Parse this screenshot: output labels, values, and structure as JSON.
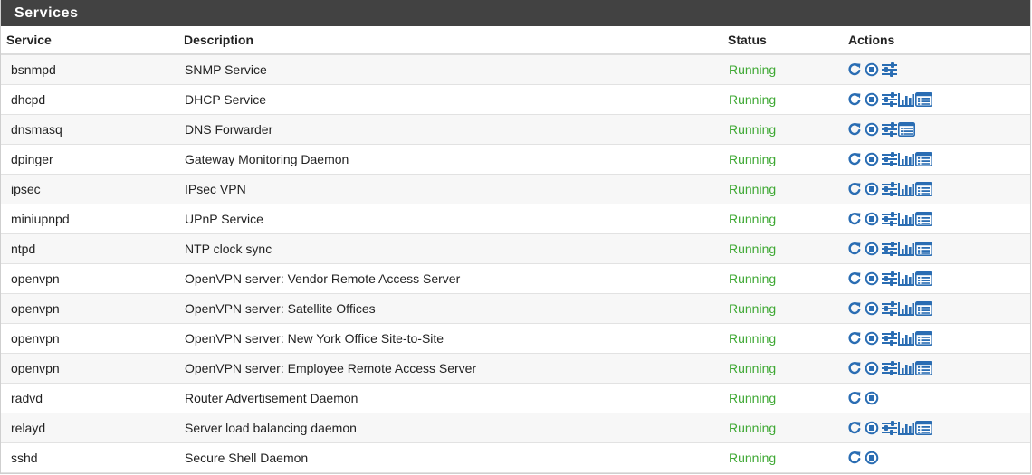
{
  "panel": {
    "title": "Services"
  },
  "table": {
    "headers": {
      "service": "Service",
      "description": "Description",
      "status": "Status",
      "actions": "Actions"
    },
    "rows": [
      {
        "service": "bsnmpd",
        "description": "SNMP Service",
        "status": "Running",
        "actions": [
          "restart-icon",
          "stop-icon",
          "settings-sliders-icon"
        ]
      },
      {
        "service": "dhcpd",
        "description": "DHCP Service",
        "status": "Running",
        "actions": [
          "restart-icon",
          "stop-icon",
          "settings-sliders-icon",
          "status-chart-icon",
          "logs-list-icon"
        ]
      },
      {
        "service": "dnsmasq",
        "description": "DNS Forwarder",
        "status": "Running",
        "actions": [
          "restart-icon",
          "stop-icon",
          "settings-sliders-icon",
          "logs-list-icon"
        ]
      },
      {
        "service": "dpinger",
        "description": "Gateway Monitoring Daemon",
        "status": "Running",
        "actions": [
          "restart-icon",
          "stop-icon",
          "settings-sliders-icon",
          "status-chart-icon",
          "logs-list-icon"
        ]
      },
      {
        "service": "ipsec",
        "description": "IPsec VPN",
        "status": "Running",
        "actions": [
          "restart-icon",
          "stop-icon",
          "settings-sliders-icon",
          "status-chart-icon",
          "logs-list-icon"
        ]
      },
      {
        "service": "miniupnpd",
        "description": "UPnP Service",
        "status": "Running",
        "actions": [
          "restart-icon",
          "stop-icon",
          "settings-sliders-icon",
          "status-chart-icon",
          "logs-list-icon"
        ]
      },
      {
        "service": "ntpd",
        "description": "NTP clock sync",
        "status": "Running",
        "actions": [
          "restart-icon",
          "stop-icon",
          "settings-sliders-icon",
          "status-chart-icon",
          "logs-list-icon"
        ]
      },
      {
        "service": "openvpn",
        "description": "OpenVPN server: Vendor Remote Access Server",
        "status": "Running",
        "actions": [
          "restart-icon",
          "stop-icon",
          "settings-sliders-icon",
          "status-chart-icon",
          "logs-list-icon"
        ]
      },
      {
        "service": "openvpn",
        "description": "OpenVPN server: Satellite Offices",
        "status": "Running",
        "actions": [
          "restart-icon",
          "stop-icon",
          "settings-sliders-icon",
          "status-chart-icon",
          "logs-list-icon"
        ]
      },
      {
        "service": "openvpn",
        "description": "OpenVPN server: New York Office Site-to-Site",
        "status": "Running",
        "actions": [
          "restart-icon",
          "stop-icon",
          "settings-sliders-icon",
          "status-chart-icon",
          "logs-list-icon"
        ]
      },
      {
        "service": "openvpn",
        "description": "OpenVPN server: Employee Remote Access Server",
        "status": "Running",
        "actions": [
          "restart-icon",
          "stop-icon",
          "settings-sliders-icon",
          "status-chart-icon",
          "logs-list-icon"
        ]
      },
      {
        "service": "radvd",
        "description": "Router Advertisement Daemon",
        "status": "Running",
        "actions": [
          "restart-icon",
          "stop-icon"
        ]
      },
      {
        "service": "relayd",
        "description": "Server load balancing daemon",
        "status": "Running",
        "actions": [
          "restart-icon",
          "stop-icon",
          "settings-sliders-icon",
          "status-chart-icon",
          "logs-list-icon"
        ]
      },
      {
        "service": "sshd",
        "description": "Secure Shell Daemon",
        "status": "Running",
        "actions": [
          "restart-icon",
          "stop-icon"
        ]
      }
    ]
  },
  "colors": {
    "header_bg": "#424242",
    "status_running": "#3ea833",
    "icon_blue": "#2a6db3"
  }
}
